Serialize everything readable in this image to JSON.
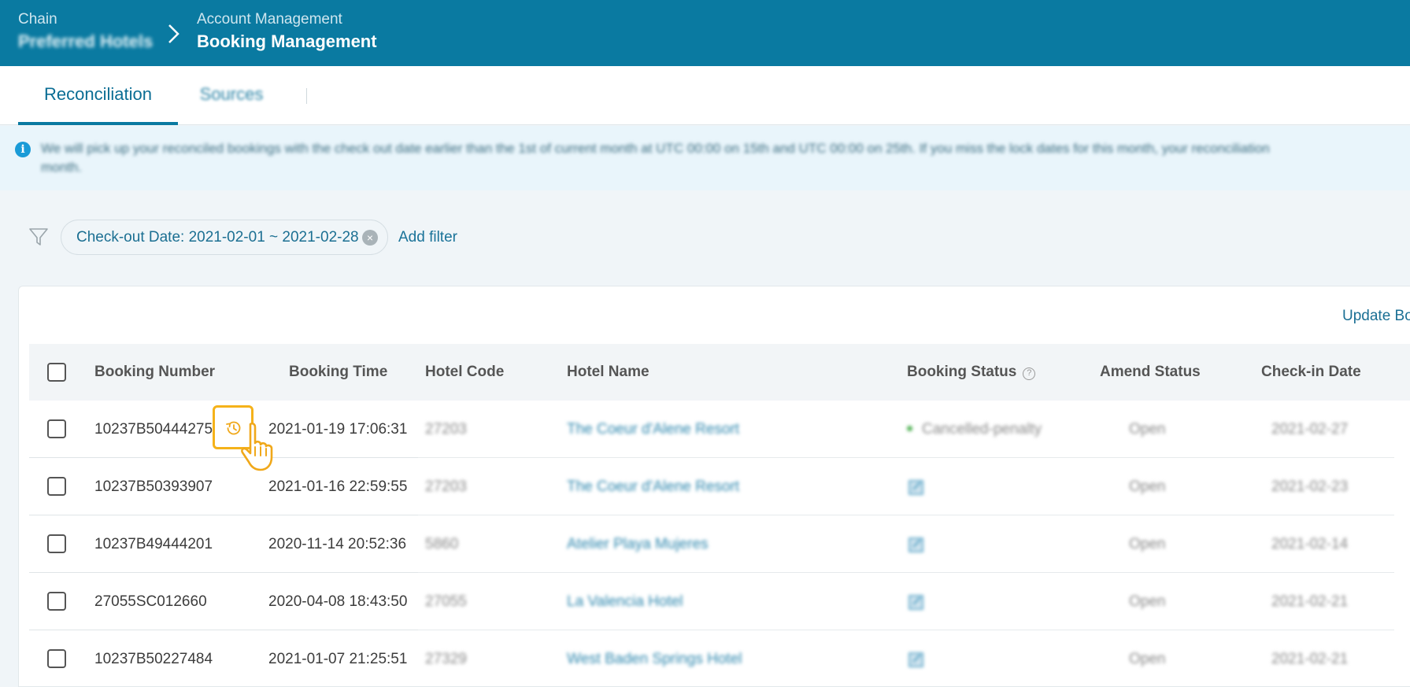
{
  "header": {
    "breadcrumb_left_small": "Chain",
    "breadcrumb_left_big": "Preferred Hotels",
    "breadcrumb_right_small": "Account Management",
    "breadcrumb_right_big": "Booking Management"
  },
  "tabs": [
    {
      "label": "Reconciliation",
      "active": true
    },
    {
      "label": "Sources",
      "active": false
    }
  ],
  "notice": {
    "text": "We will pick up your reconciled bookings with the check out date earlier than the 1st of current month at UTC 00:00 on 15th and UTC 00:00 on 25th. If you miss the lock dates for this month, your reconciliation",
    "text_line2": "month."
  },
  "filter": {
    "chip_label": "Check-out Date: 2021-02-01 ~ 2021-02-28",
    "add_filter_label": "Add filter"
  },
  "table": {
    "update_button_label": "Update Bo",
    "columns": {
      "booking_number": "Booking Number",
      "booking_time": "Booking Time",
      "hotel_code": "Hotel Code",
      "hotel_name": "Hotel Name",
      "booking_status": "Booking Status",
      "amend_status": "Amend Status",
      "check_in_date": "Check-in Date"
    },
    "rows": [
      {
        "booking_number": "10237B50444275",
        "booking_time": "2021-01-19 17:06:31",
        "hotel_code": "27203",
        "hotel_name": "The Coeur d'Alene Resort",
        "booking_status": "Cancelled-penalty",
        "amend_status": "Open",
        "check_in_date": "2021-02-27"
      },
      {
        "booking_number": "10237B50393907",
        "booking_time": "2021-01-16 22:59:55",
        "hotel_code": "27203",
        "hotel_name": "The Coeur d'Alene Resort",
        "booking_status": "",
        "amend_status": "Open",
        "check_in_date": "2021-02-23"
      },
      {
        "booking_number": "10237B49444201",
        "booking_time": "2020-11-14 20:52:36",
        "hotel_code": "5860",
        "hotel_name": "Atelier Playa Mujeres",
        "booking_status": "",
        "amend_status": "Open",
        "check_in_date": "2021-02-14"
      },
      {
        "booking_number": "27055SC012660",
        "booking_time": "2020-04-08 18:43:50",
        "hotel_code": "27055",
        "hotel_name": "La Valencia Hotel",
        "booking_status": "",
        "amend_status": "Open",
        "check_in_date": "2021-02-21"
      },
      {
        "booking_number": "10237B50227484",
        "booking_time": "2021-01-07 21:25:51",
        "hotel_code": "27329",
        "hotel_name": "West Baden Springs Hotel",
        "booking_status": "",
        "amend_status": "Open",
        "check_in_date": "2021-02-21"
      }
    ]
  },
  "colors": {
    "header_bg": "#0a7aa1",
    "accent": "#0a6d94",
    "highlight": "#f5b21a",
    "notice_bg": "#e9f5fb"
  }
}
